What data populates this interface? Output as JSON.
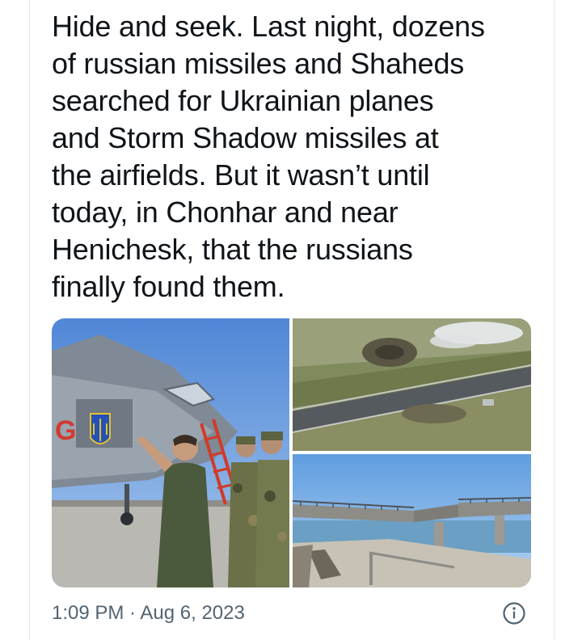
{
  "tweet": {
    "text": "Hide and seek. Last night, dozens\nof russian missiles and Shaheds\nsearched for Ukrainian planes\nand Storm Shadow missiles at\nthe airfields. But it wasn’t until\ntoday, in Chonhar and near\nHenichesk, that the russians\nfinally found them.",
    "timestamp": "1:09 PM · Aug 6, 2023"
  },
  "media": [
    {
      "subject": "soldiers-signing-fighter-jet"
    },
    {
      "subject": "damaged-bridge-aerial-view"
    },
    {
      "subject": "collapsed-bridge-span"
    }
  ],
  "colors": {
    "text": "#0f1419",
    "secondary": "#536471",
    "border": "#e1e8ed"
  },
  "icons": {
    "info": "info-circle-icon"
  }
}
